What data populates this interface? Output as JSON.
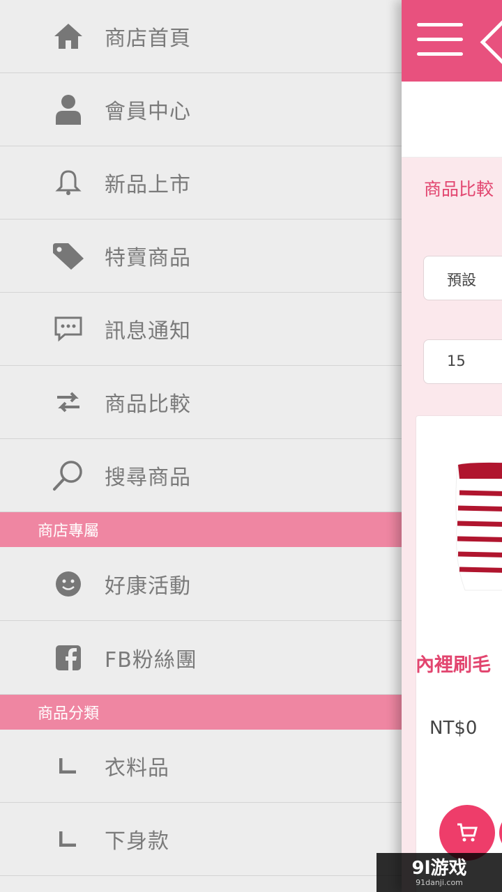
{
  "drawer": {
    "items": [
      {
        "label": "商店首頁",
        "icon": "home-icon"
      },
      {
        "label": "會員中心",
        "icon": "user-icon"
      },
      {
        "label": "新品上市",
        "icon": "bell-icon"
      },
      {
        "label": "特賣商品",
        "icon": "tag-icon"
      },
      {
        "label": "訊息通知",
        "icon": "chat-icon"
      },
      {
        "label": "商品比較",
        "icon": "compare-arrows-icon"
      },
      {
        "label": "搜尋商品",
        "icon": "search-icon"
      }
    ],
    "section_store": "商店專屬",
    "store_items": [
      {
        "label": "好康活動",
        "icon": "smiley-icon"
      },
      {
        "label": "FB粉絲團",
        "icon": "facebook-icon"
      }
    ],
    "section_category": "商品分類",
    "category_items": [
      {
        "label": "衣料品",
        "icon": "corner-icon"
      },
      {
        "label": "下身款",
        "icon": "corner-icon"
      }
    ]
  },
  "main": {
    "compare_link": "商品比較",
    "sort_select": "預設",
    "per_page_select": "15",
    "product_name": "內裡刷毛",
    "product_price": "NT$0"
  },
  "watermark": {
    "text": "9l游戏",
    "sub": "91danji.com"
  },
  "colors": {
    "accent": "#e8517e",
    "section": "#ef86a2",
    "pink_text": "#e2456f"
  }
}
